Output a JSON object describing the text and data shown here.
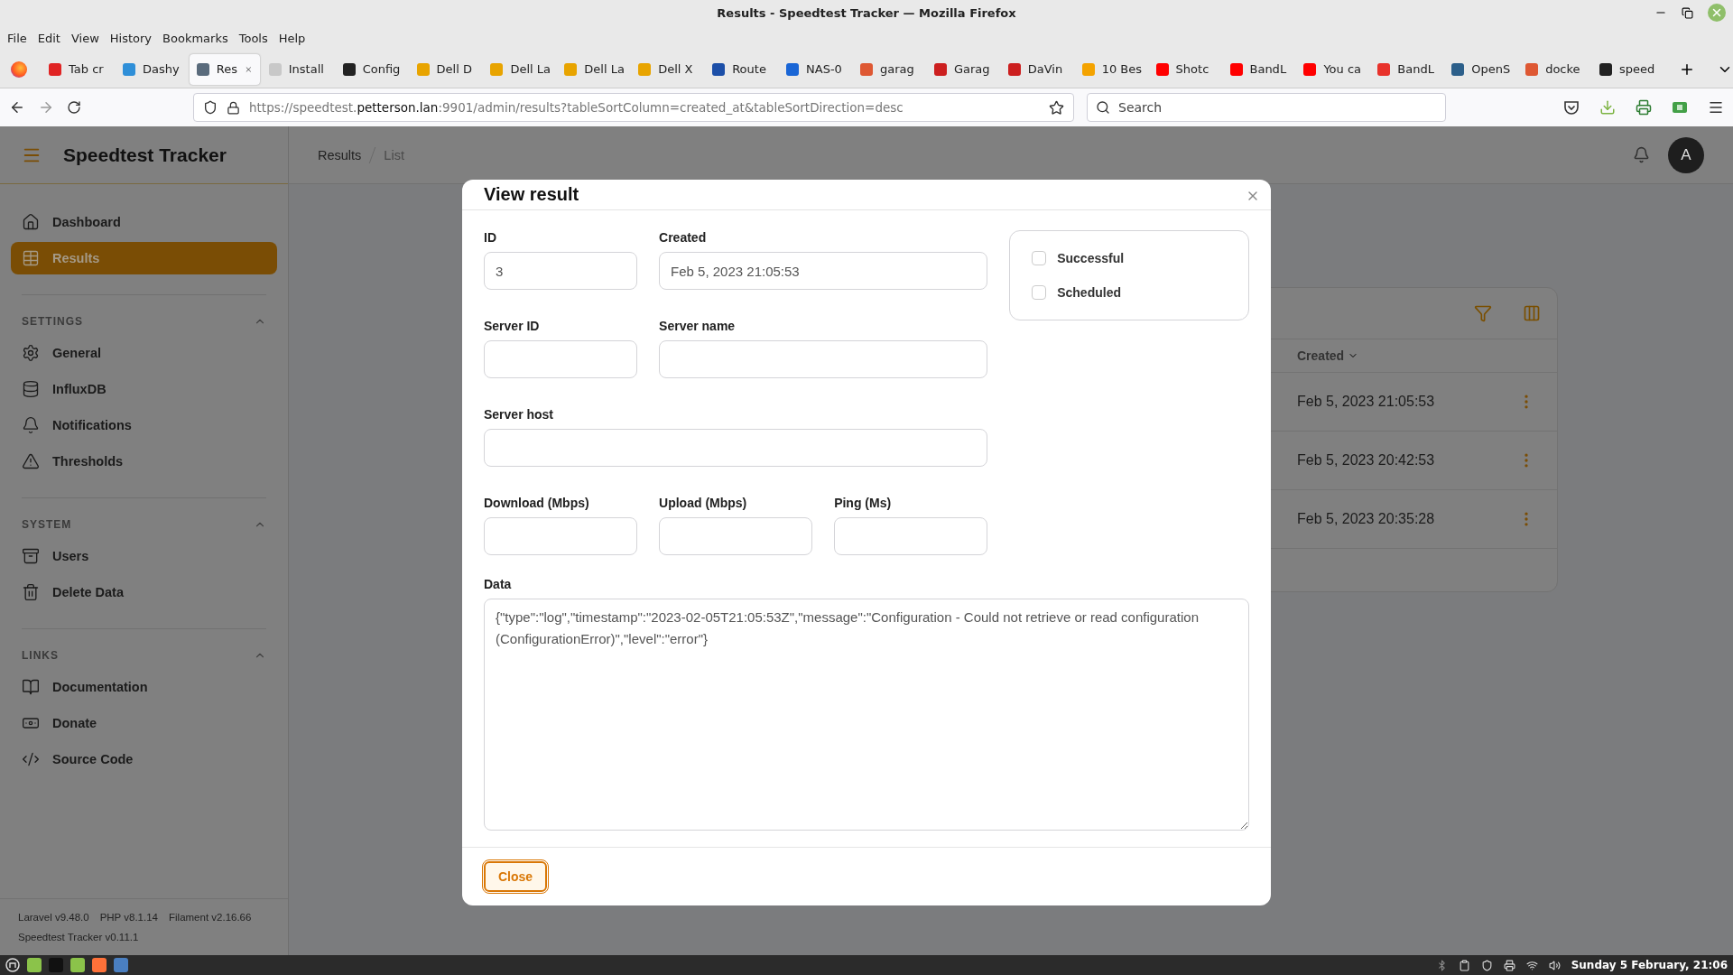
{
  "window": {
    "title": "Results - Speedtest Tracker — Mozilla Firefox"
  },
  "menu_bar": [
    "File",
    "Edit",
    "View",
    "History",
    "Bookmarks",
    "Tools",
    "Help"
  ],
  "tabs": [
    {
      "label": "Tab cr",
      "selected": false,
      "color": "#e02424"
    },
    {
      "label": "Dashy",
      "selected": false,
      "color": "#2f8fd8"
    },
    {
      "label": "Res",
      "selected": true,
      "color": "#5a6b7c"
    },
    {
      "label": "Install",
      "selected": false,
      "color": "#c8c8c8"
    },
    {
      "label": "Config",
      "selected": false,
      "color": "#222222"
    },
    {
      "label": "Dell D",
      "selected": false,
      "color": "#e8a400"
    },
    {
      "label": "Dell La",
      "selected": false,
      "color": "#e8a400"
    },
    {
      "label": "Dell La",
      "selected": false,
      "color": "#e8a400"
    },
    {
      "label": "Dell X",
      "selected": false,
      "color": "#e8a400"
    },
    {
      "label": "Route",
      "selected": false,
      "color": "#1c4fa8"
    },
    {
      "label": "NAS-0",
      "selected": false,
      "color": "#1a66d6"
    },
    {
      "label": "garag",
      "selected": false,
      "color": "#de5833"
    },
    {
      "label": "Garag",
      "selected": false,
      "color": "#cc1f1f"
    },
    {
      "label": "DaVin",
      "selected": false,
      "color": "#cc1f1f"
    },
    {
      "label": "10 Bes",
      "selected": false,
      "color": "#f4a300"
    },
    {
      "label": "Shotc",
      "selected": false,
      "color": "#ff0000"
    },
    {
      "label": "BandL",
      "selected": false,
      "color": "#ff0000"
    },
    {
      "label": "You ca",
      "selected": false,
      "color": "#ff0000"
    },
    {
      "label": "BandL",
      "selected": false,
      "color": "#e8322b"
    },
    {
      "label": "OpenS",
      "selected": false,
      "color": "#2c5f8a"
    },
    {
      "label": "docke",
      "selected": false,
      "color": "#de5833"
    },
    {
      "label": "speed",
      "selected": false,
      "color": "#222222"
    }
  ],
  "address_bar": {
    "url_scheme": "https://speedtest.",
    "url_domain": "petterson.lan",
    "url_path": ":9901/admin/results?tableSortColumn=created_at&tableSortDirection=desc"
  },
  "search": {
    "placeholder": "Search"
  },
  "app": {
    "brand": "Speedtest Tracker",
    "breadcrumbs": [
      "Results",
      "List"
    ],
    "avatar": "A"
  },
  "sidebar": {
    "items": [
      {
        "label": "Dashboard",
        "selected": false
      },
      {
        "label": "Results",
        "selected": true
      }
    ],
    "groups": [
      {
        "heading": "SETTINGS",
        "items": [
          {
            "label": "General"
          },
          {
            "label": "InfluxDB"
          },
          {
            "label": "Notifications"
          },
          {
            "label": "Thresholds"
          }
        ]
      },
      {
        "heading": "SYSTEM",
        "items": [
          {
            "label": "Users"
          },
          {
            "label": "Delete Data"
          }
        ]
      },
      {
        "heading": "LINKS",
        "items": [
          {
            "label": "Documentation"
          },
          {
            "label": "Donate"
          },
          {
            "label": "Source Code"
          }
        ]
      }
    ],
    "footer": [
      "Laravel v9.48.0",
      "PHP v8.1.14",
      "Filament v2.16.66",
      "Speedtest Tracker v0.11.1"
    ]
  },
  "table": {
    "columns": [
      "Created"
    ],
    "rows": [
      {
        "created": "Feb 5, 2023 21:05:53"
      },
      {
        "created": "Feb 5, 2023 20:42:53"
      },
      {
        "created": "Feb 5, 2023 20:35:28"
      }
    ]
  },
  "modal": {
    "title": "View result",
    "fields": [
      {
        "label": "ID",
        "value": "3",
        "kind": "short"
      },
      {
        "label": "Created",
        "value": "Feb 5, 2023 21:05:53",
        "kind": "wide"
      },
      {
        "label": "Server ID",
        "kind": "short"
      },
      {
        "label": "Server name",
        "kind": "wide"
      },
      {
        "label": "Server host",
        "kind": "full"
      },
      {
        "label": "Download (Mbps)",
        "kind": "short"
      },
      {
        "label": "Upload (Mbps)",
        "kind": "short"
      },
      {
        "label": "Ping (Ms)",
        "kind": "short"
      }
    ],
    "checkboxes": [
      {
        "label": "Successful",
        "checked": false
      },
      {
        "label": "Scheduled",
        "checked": false
      }
    ],
    "data": {
      "label": "Data",
      "value": "{\"type\":\"log\",\"timestamp\":\"2023-02-05T21:05:53Z\",\"message\":\"Configuration - Could not retrieve or read configuration (ConfigurationError)\",\"level\":\"error\"}"
    },
    "buttons": [
      "Close"
    ]
  },
  "taskbar": {
    "clock": "Sunday  5 February, 21:06"
  }
}
